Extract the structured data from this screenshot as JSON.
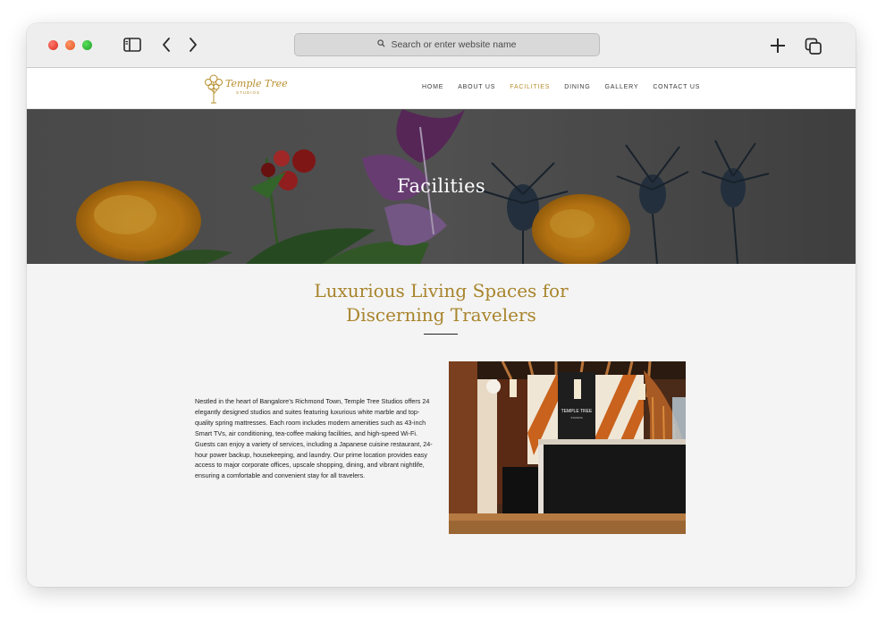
{
  "browser": {
    "address_placeholder": "Search or enter website name",
    "icons": [
      "sidebar-icon",
      "back-icon",
      "forward-icon",
      "search-icon",
      "new-tab-icon",
      "tabs-overview-icon"
    ]
  },
  "site": {
    "logo_text": "Temple Tree",
    "logo_subtext": "STUDIOS",
    "nav": [
      {
        "label": "HOME",
        "active": false
      },
      {
        "label": "ABOUT US",
        "active": false
      },
      {
        "label": "FACILITIES",
        "active": true
      },
      {
        "label": "DINING",
        "active": false
      },
      {
        "label": "GALLERY",
        "active": false
      },
      {
        "label": "CONTACT US",
        "active": false
      }
    ],
    "hero_title": "Facilities",
    "heading_line1": "Luxurious Living Spaces for",
    "heading_line2": "Discerning Travelers",
    "paragraph": "Nestled in the heart of Bangalore’s Richmond Town, Temple Tree Studios offers 24 elegantly designed studios and suites featuring luxurious white marble and top-quality spring mattresses. Each room includes modern amenities such as 43-inch Smart TVs, air conditioning, tea-coffee making facilities, and high-speed Wi-Fi. Guests can enjoy a variety of services, including a Japanese cuisine restaurant, 24-hour power backup, housekeeping, and laundry. Our prime location provides easy access to major corporate offices, upscale shopping, dining, and vibrant nightlife, ensuring a comfortable and convenient stay for all travelers.",
    "reception_sign_line1": "TEMPLE TREE",
    "reception_sign_line2": "STUDIOS"
  },
  "colors": {
    "accent_gold": "#b78f2e",
    "heading_gold": "#a8842c",
    "hero_bg": "#555555",
    "page_bg": "#f4f4f4"
  }
}
